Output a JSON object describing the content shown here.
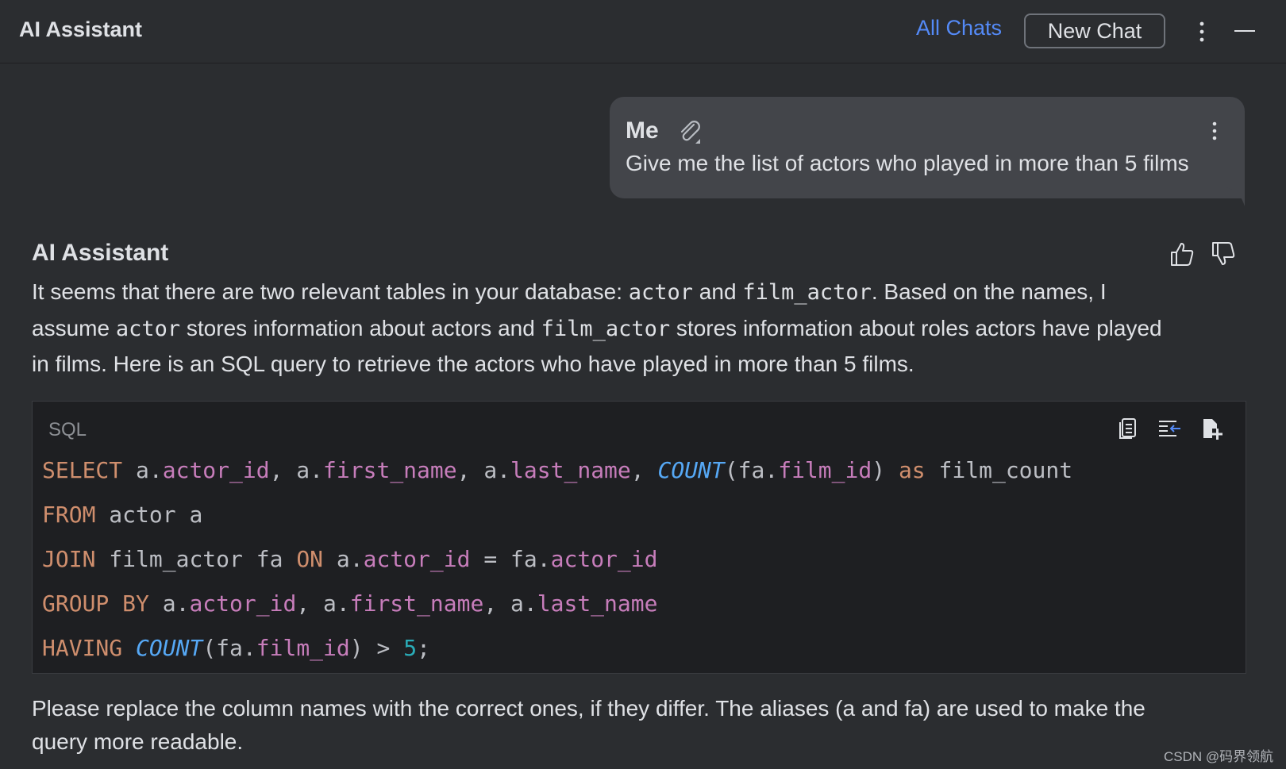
{
  "header": {
    "title": "AI Assistant",
    "all_chats_label": "All Chats",
    "new_chat_label": "New Chat"
  },
  "user_message": {
    "author": "Me",
    "text": "Give me the list of actors who played in more than 5 films"
  },
  "assistant_message": {
    "author": "AI Assistant",
    "para1_line1": {
      "t1": "It seems that there are two relevant tables in your database: ",
      "c1": "actor",
      "t2": " and ",
      "c2": "film_actor",
      "t3": ". Based on the names, I"
    },
    "para1_line2": {
      "t1": "assume ",
      "c1": "actor",
      "t2": " stores information about actors and ",
      "c2": "film_actor",
      "t3": " stores information about roles actors have played"
    },
    "para1_line3": "in films. Here is an SQL query to retrieve the actors who have played in more than 5 films.",
    "code": {
      "language": "SQL",
      "line1": {
        "k1": "SELECT",
        "t1": " a.",
        "f1": "actor_id",
        "t2": ", a.",
        "f2": "first_name",
        "t3": ", a.",
        "f3": "last_name",
        "t4": ", ",
        "fn1": "COUNT",
        "t5": "(fa.",
        "f4": "film_id",
        "t6": ") ",
        "k2": "as",
        "t7": " film_count"
      },
      "line2": {
        "k1": "FROM",
        "t1": " actor a"
      },
      "line3": {
        "k1": "JOIN",
        "t1": " film_actor fa ",
        "k2": "ON",
        "t2": " a.",
        "f1": "actor_id",
        "t3": " = fa.",
        "f2": "actor_id"
      },
      "line4": {
        "k1": "GROUP BY",
        "t1": " a.",
        "f1": "actor_id",
        "t2": ", a.",
        "f2": "first_name",
        "t3": ", a.",
        "f3": "last_name"
      },
      "line5": {
        "k1": "HAVING",
        "t1": " ",
        "fn1": "COUNT",
        "t2": "(fa.",
        "f1": "film_id",
        "t3": ") > ",
        "n1": "5",
        "t4": ";"
      }
    },
    "para2_line1": "Please replace the column names with the correct ones, if they differ. The aliases (a and fa) are used to make the",
    "para2_line2": "query more readable."
  },
  "colors": {
    "background": "#2b2d30",
    "bubble": "#43454a",
    "code_background": "#1e1f22",
    "link": "#548af7",
    "keyword": "#cf8e6d",
    "field": "#c77dbb",
    "function": "#56a8f5",
    "number": "#2aacb8"
  },
  "icons": {
    "toolbar": [
      "more-vertical-icon",
      "minimize-icon"
    ],
    "message": [
      "paperclip-icon",
      "more-vertical-icon"
    ],
    "feedback": [
      "thumbs-up-icon",
      "thumbs-down-icon"
    ],
    "code": [
      "copy-icon",
      "insert-at-caret-icon",
      "new-file-icon"
    ]
  },
  "watermark": "CSDN @码界领航"
}
